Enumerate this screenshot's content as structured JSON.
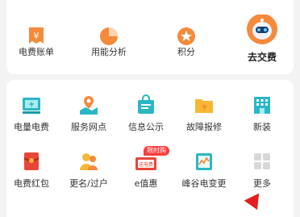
{
  "top_row": [
    {
      "label": "电费账单",
      "icon": "bill-icon"
    },
    {
      "label": "用能分析",
      "icon": "pie-chart-icon"
    },
    {
      "label": "积分",
      "icon": "star-icon"
    },
    {
      "label": "去交费",
      "icon": "robot-mascot-icon"
    }
  ],
  "grid_row1": [
    {
      "label": "电量电费",
      "icon": "electric-meter-icon"
    },
    {
      "label": "服务网点",
      "icon": "map-pin-icon"
    },
    {
      "label": "信息公示",
      "icon": "notice-bag-icon"
    },
    {
      "label": "故障报修",
      "icon": "repair-folder-icon"
    },
    {
      "label": "新装",
      "icon": "building-icon"
    }
  ],
  "grid_row2": [
    {
      "label": "电费红包",
      "icon": "red-envelope-icon"
    },
    {
      "label": "更名/过户",
      "icon": "users-icon"
    },
    {
      "label": "e值惠",
      "icon": "coupon-icon",
      "badge": "限时购",
      "coupon_text": "送电费"
    },
    {
      "label": "峰谷电变更",
      "icon": "chart-doc-icon"
    },
    {
      "label": "更多",
      "icon": "grid-more-icon"
    }
  ],
  "colors": {
    "orange": "#f58a3a",
    "red": "#e9463a",
    "teal": "#2bb6c5",
    "yellow": "#f7b733"
  }
}
